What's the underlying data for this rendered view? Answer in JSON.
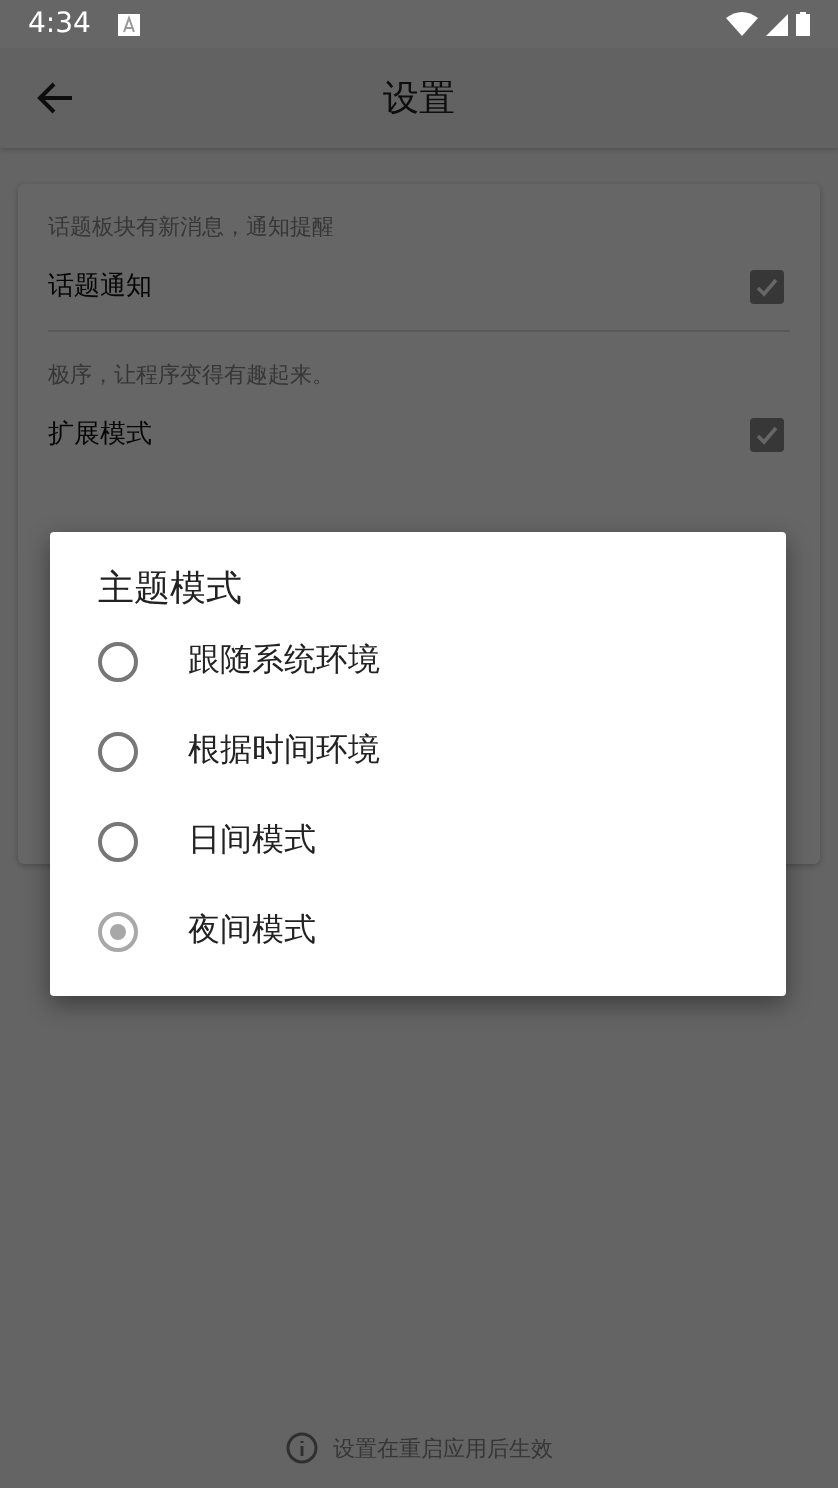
{
  "status_bar": {
    "time": "4:34"
  },
  "app_bar": {
    "title": "设置"
  },
  "settings": [
    {
      "hint": "话题板块有新消息，通知提醒",
      "label": "话题通知",
      "checked": true
    },
    {
      "hint": "极序，让程序变得有趣起来。",
      "label": "扩展模式",
      "checked": true
    }
  ],
  "footer_note": "设置在重启应用后生效",
  "dialog": {
    "title": "主题模式",
    "options": [
      {
        "label": "跟随系统环境",
        "selected": false
      },
      {
        "label": "根据时间环境",
        "selected": false
      },
      {
        "label": "日间模式",
        "selected": false
      },
      {
        "label": "夜间模式",
        "selected": true
      }
    ]
  }
}
